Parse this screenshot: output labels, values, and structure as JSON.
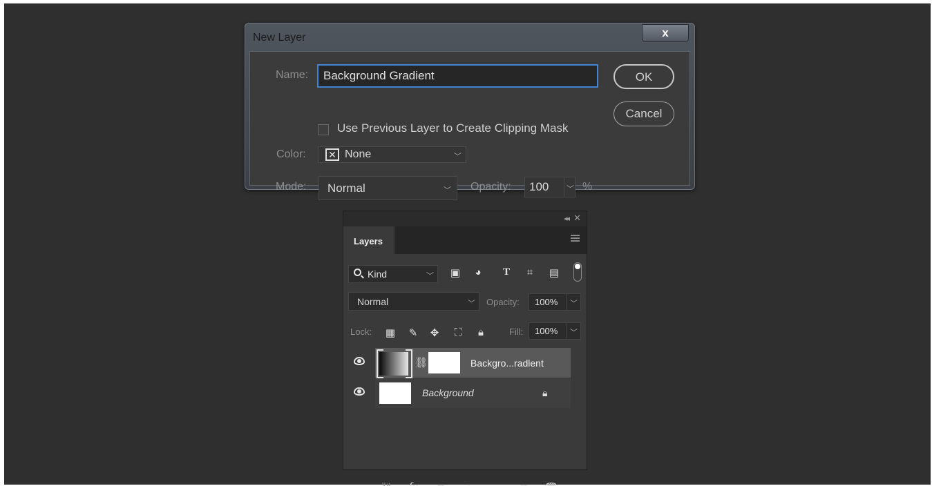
{
  "dialog": {
    "title": "New Layer",
    "close_label": "x",
    "name_label": "Name:",
    "name_value": "Background Gradient",
    "clipping_label": "Use Previous Layer to Create Clipping Mask",
    "color_label": "Color:",
    "color_value": "None",
    "mode_label": "Mode:",
    "mode_value": "Normal",
    "opacity_label": "Opacity:",
    "opacity_value": "100",
    "percent": "%",
    "ok_label": "OK",
    "cancel_label": "Cancel"
  },
  "panel": {
    "tab_label": "Layers",
    "kind_value": "Kind",
    "blend_mode": "Normal",
    "opacity_label": "Opacity:",
    "opacity_value": "100%",
    "lock_label": "Lock:",
    "fill_label": "Fill:",
    "fill_value": "100%",
    "filter_icons": [
      "image-filter-icon",
      "adjustment-filter-icon",
      "type-filter-icon",
      "shape-filter-icon",
      "smart-object-filter-icon"
    ],
    "layers": [
      {
        "name": "Backgro...radlent",
        "selected": true,
        "visible": true
      },
      {
        "name": "Background",
        "locked": true,
        "visible": true
      }
    ],
    "bottom_icons": [
      "link-icon",
      "fx-icon",
      "mask-icon",
      "adjustment-icon",
      "folder-icon",
      "new-layer-icon",
      "trash-icon"
    ]
  },
  "colors": {
    "canvas": "#2f2f2f",
    "accent_focus": "#3f87d6",
    "selected_row": "#595959"
  }
}
